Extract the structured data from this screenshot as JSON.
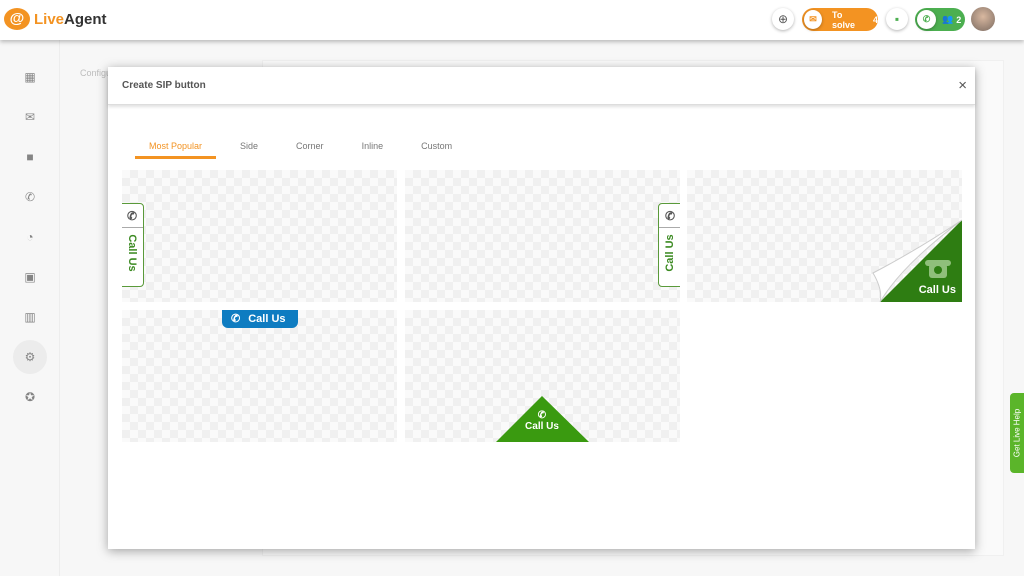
{
  "app": {
    "logo_at": "@",
    "logo_live": "Live",
    "logo_agent": "Agent"
  },
  "topbar": {
    "to_solve_label": "To solve",
    "to_solve_count": "4",
    "calls_count": "2"
  },
  "background": {
    "panel_title": "Configu"
  },
  "modal": {
    "title": "Create SIP button",
    "close": "×",
    "tabs": [
      {
        "label": "Most Popular",
        "active": true
      },
      {
        "label": "Side"
      },
      {
        "label": "Corner"
      },
      {
        "label": "Inline"
      },
      {
        "label": "Custom"
      }
    ],
    "buttons": [
      {
        "style": "side-left",
        "label": "Call Us",
        "color": "#3c8a22"
      },
      {
        "style": "side-right",
        "label": "Call Us",
        "color": "#3c8a22"
      },
      {
        "style": "corner-peel",
        "label": "Call Us",
        "color": "#2e7d12"
      },
      {
        "style": "top-tab",
        "label": "Call Us",
        "color": "#0e7cc1"
      },
      {
        "style": "bottom-triangle",
        "label": "Call Us",
        "color": "#3a9a10"
      }
    ]
  },
  "live_help": "Get Live Help",
  "colors": {
    "accent": "#f39322",
    "green": "#4caf50"
  }
}
